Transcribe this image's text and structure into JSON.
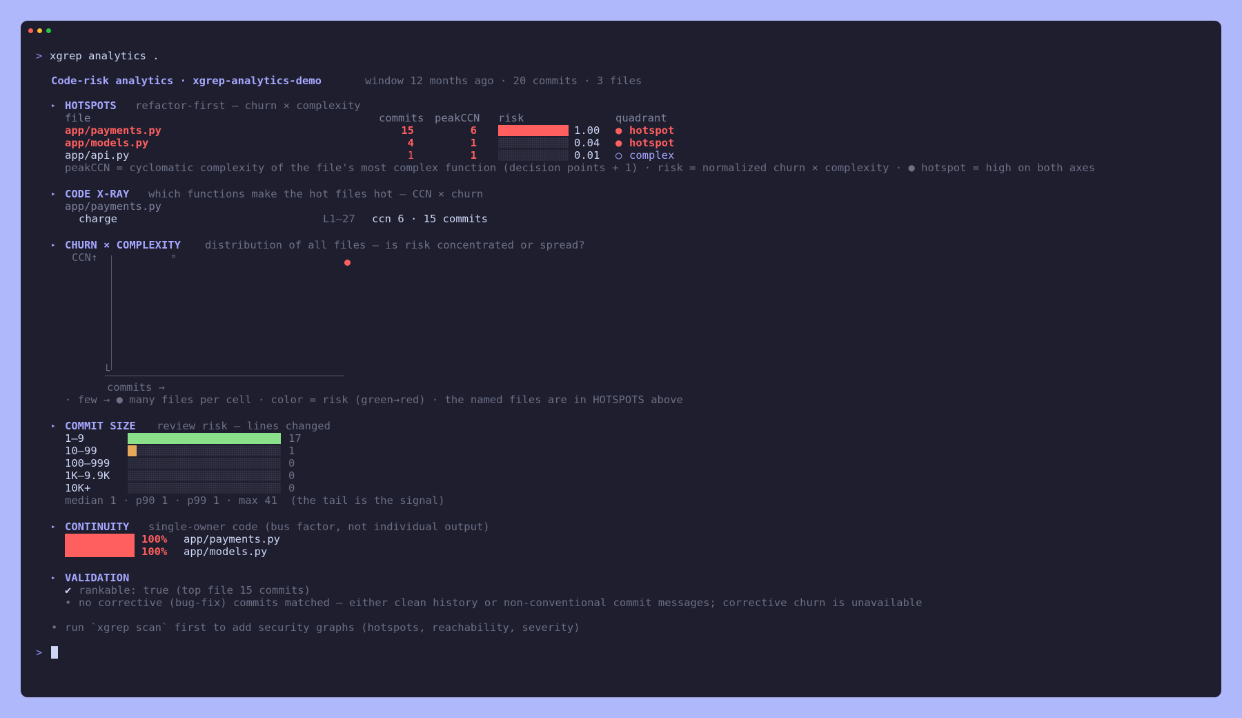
{
  "colors": {
    "accent": "#a6a7ff",
    "hot": "#ff5f5f",
    "ok": "#8be08b",
    "warn": "#e5a95b",
    "background": "#1e1e2e",
    "page": "#b0b8fc"
  },
  "prompt": {
    "caret": ">",
    "command": "xgrep analytics ."
  },
  "header": {
    "title": "Code-risk analytics · xgrep-analytics-demo",
    "meta": "window 12 months ago · 20 commits · 3 files"
  },
  "hotspots": {
    "title": "HOTSPOTS",
    "subtitle": "refactor-first — churn × complexity",
    "columns": [
      "file",
      "commits",
      "peakCCN",
      "risk",
      "quadrant"
    ],
    "rows": [
      {
        "file": "app/payments.py",
        "commits": "15",
        "peak": "6",
        "risk": 1.0,
        "risk_label": "1.00",
        "quadrant": "hotspot",
        "quadrant_icon": "●"
      },
      {
        "file": "app/models.py",
        "commits": "4",
        "peak": "1",
        "risk": 0.04,
        "risk_label": "0.04",
        "quadrant": "hotspot",
        "quadrant_icon": "●"
      },
      {
        "file": "app/api.py",
        "commits": "1",
        "peak": "1",
        "risk": 0.01,
        "risk_label": "0.01",
        "quadrant": "complex",
        "quadrant_icon": "○"
      }
    ],
    "note": "peakCCN = cyclomatic complexity of the file's most complex function (decision points + 1) · risk = normalized churn × complexity · ● hotspot = high on both axes"
  },
  "xray": {
    "title": "CODE X-RAY",
    "subtitle": "which functions make the hot files hot — CCN × churn",
    "file": "app/payments.py",
    "func": "charge",
    "lines": "L1–27",
    "stats": "ccn 6 · 15 commits"
  },
  "churn": {
    "title": "CHURN × COMPLEXITY",
    "subtitle": "distribution of all files — is risk concentrated or spread?",
    "y_label": "CCN↑",
    "x_label": "commits →",
    "small_mark": "°",
    "legend": "· few → ● many files per cell · color = risk (green→red) · the named files are in HOTSPOTS above"
  },
  "commit_size": {
    "title": "COMMIT SIZE",
    "subtitle": "review risk — lines changed",
    "max": 17,
    "rows": [
      {
        "label": "1–9",
        "count": 17,
        "count_label": "17"
      },
      {
        "label": "10–99",
        "count": 1,
        "count_label": "1"
      },
      {
        "label": "100–999",
        "count": 0,
        "count_label": "0"
      },
      {
        "label": "1K–9.9K",
        "count": 0,
        "count_label": "0"
      },
      {
        "label": "10K+",
        "count": 0,
        "count_label": "0"
      }
    ],
    "summary": "median 1 · p90 1 · p99 1 · max 41  (the tail is the signal)"
  },
  "continuity": {
    "title": "CONTINUITY",
    "subtitle": "single-owner code (bus factor, not individual output)",
    "rows": [
      {
        "pct": "100%",
        "file": "app/payments.py"
      },
      {
        "pct": "100%",
        "file": "app/models.py"
      }
    ]
  },
  "validation": {
    "title": "VALIDATION",
    "check_icon": "✔",
    "check": "rankable: true (top file 15 commits)",
    "bullet": "•",
    "note": "no corrective (bug-fix) commits matched — either clean history or non-conventional commit messages; corrective churn is unavailable"
  },
  "footer": {
    "bullet": "•",
    "note": "run `xgrep scan` first to add security graphs (hotspots, reachability, severity)"
  },
  "section_marker": "▸",
  "tree_corner": "└"
}
